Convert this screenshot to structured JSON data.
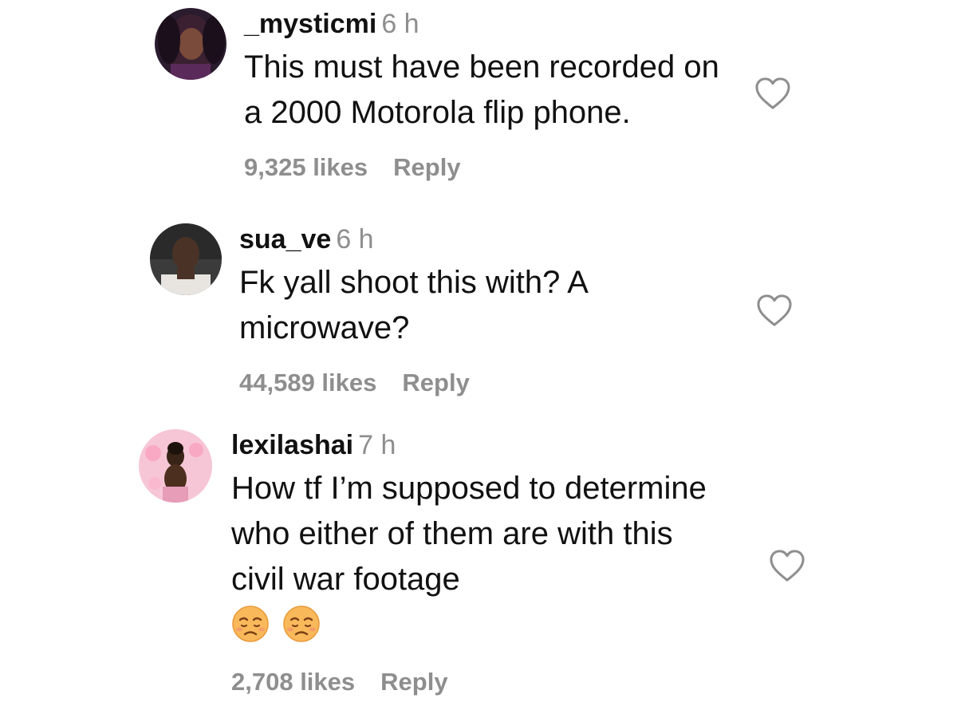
{
  "colors": {
    "background": "#ffffff",
    "text": "#111111",
    "secondary": "#8e8e8e",
    "heart_outline": "#8e8e8e"
  },
  "comments": [
    {
      "username": "_mysticmi",
      "time": "6 h",
      "text": "This must have been recorded on a 2000 Motorola flip phone.",
      "likes": "9,325 likes",
      "reply_label": "Reply",
      "icon": "heart-outline-icon"
    },
    {
      "username": "sua_ve",
      "time": "6 h",
      "text": "Fk yall shoot this with? A microwave?",
      "likes": "44,589 likes",
      "reply_label": "Reply",
      "icon": "heart-outline-icon"
    },
    {
      "username": "lexilashai",
      "time": "7 h",
      "text": "How tf I’m supposed to determine who either of them are with this civil war footage",
      "emojis": [
        "😞",
        "😞"
      ],
      "likes": "2,708 likes",
      "reply_label": "Reply",
      "icon": "heart-outline-icon"
    }
  ]
}
